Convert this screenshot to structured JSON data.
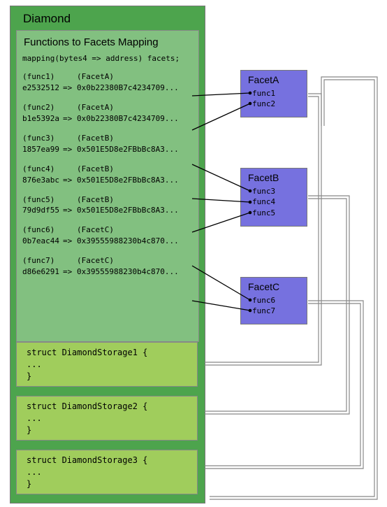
{
  "diamond": {
    "title": "Diamond",
    "mapping_panel": {
      "title": "Functions to Facets Mapping",
      "declaration": "mapping(bytes4 => address) facets;",
      "entries": [
        {
          "func_label": "(func1)",
          "facet_label": "(FacetA)",
          "selector": "e2532512",
          "arrow": "=>",
          "address": "0x0b22380B7c4234709..."
        },
        {
          "func_label": "(func2)",
          "facet_label": "(FacetA)",
          "selector": "b1e5392a",
          "arrow": "=>",
          "address": "0x0b22380B7c4234709..."
        },
        {
          "func_label": "(func3)",
          "facet_label": "(FacetB)",
          "selector": "1857ea99",
          "arrow": "=>",
          "address": "0x501E5D8e2FBbBc8A3..."
        },
        {
          "func_label": "(func4)",
          "facet_label": "(FacetB)",
          "selector": "876e3abc",
          "arrow": "=>",
          "address": "0x501E5D8e2FBbBc8A3..."
        },
        {
          "func_label": "(func5)",
          "facet_label": "(FacetB)",
          "selector": "79d9df55",
          "arrow": "=>",
          "address": "0x501E5D8e2FBbBc8A3..."
        },
        {
          "func_label": "(func6)",
          "facet_label": "(FacetC)",
          "selector": "0b7eac44",
          "arrow": "=>",
          "address": "0x39555988230b4c870..."
        },
        {
          "func_label": "(func7)",
          "facet_label": "(FacetC)",
          "selector": "d86e6291",
          "arrow": "=>",
          "address": "0x39555988230b4c870..."
        }
      ]
    },
    "structs": [
      {
        "line1": "struct DiamondStorage1 {",
        "line2": "  ...",
        "line3": "}"
      },
      {
        "line1": "struct DiamondStorage2 {",
        "line2": "  ...",
        "line3": "}"
      },
      {
        "line1": "struct DiamondStorage3 {",
        "line2": "  ...",
        "line3": "}"
      }
    ]
  },
  "facets": {
    "A": {
      "title": "FacetA",
      "funcs": [
        "func1",
        "func2"
      ]
    },
    "B": {
      "title": "FacetB",
      "funcs": [
        "func3",
        "func4",
        "func5"
      ]
    },
    "C": {
      "title": "FacetC",
      "funcs": [
        "func6",
        "func7"
      ]
    }
  }
}
